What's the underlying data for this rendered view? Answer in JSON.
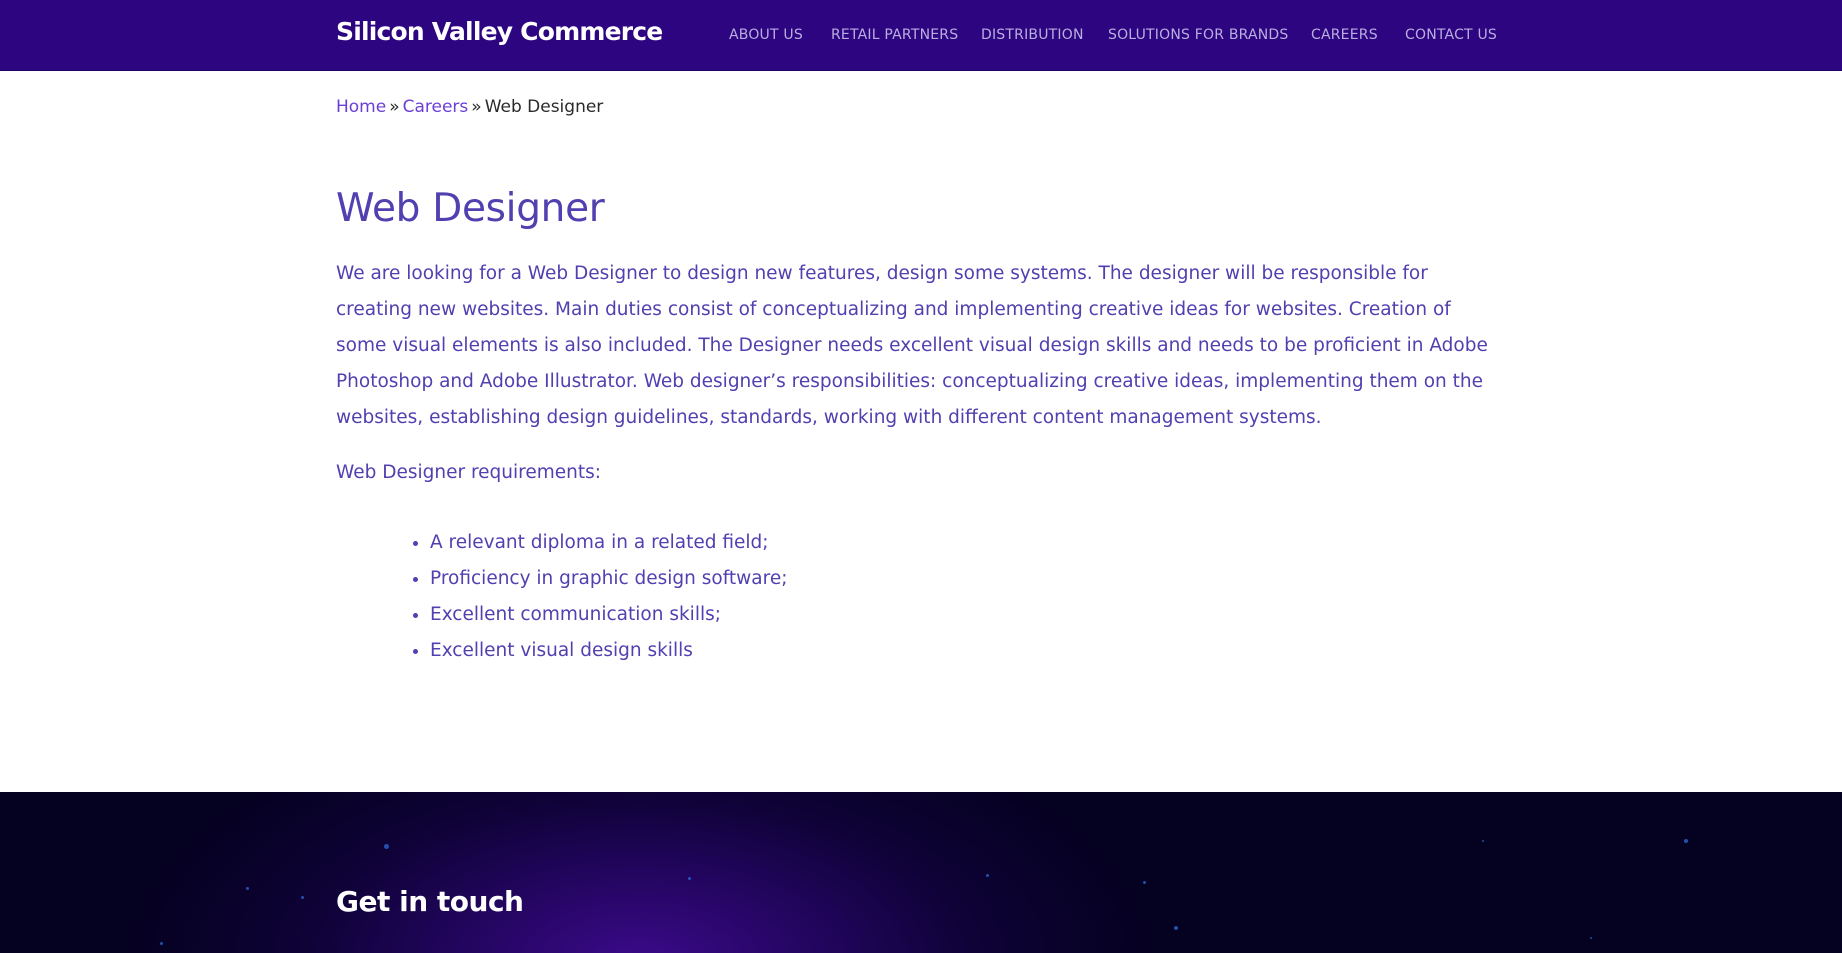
{
  "header": {
    "brand": "Silicon Valley Commerce",
    "nav": [
      {
        "label": "ABOUT US"
      },
      {
        "label": "RETAIL PARTNERS"
      },
      {
        "label": "DISTRIBUTION"
      },
      {
        "label": "SOLUTIONS FOR BRANDS"
      },
      {
        "label": "CAREERS"
      },
      {
        "label": "CONTACT US"
      }
    ]
  },
  "breadcrumb": {
    "home": "Home",
    "separator": "»",
    "careers": "Careers",
    "current": "Web Designer"
  },
  "main": {
    "title": "Web Designer",
    "intro": "We are looking for a Web Designer to design new features, design some systems. The designer will be responsible for creating new websites. Main duties consist of conceptualizing and implementing creative ideas for websites. Creation of some visual elements is also included. The Designer needs excellent visual design skills and needs to be proficient in Adobe Photoshop and Adobe Illustrator. Web designer’s responsibilities: conceptualizing creative ideas, implementing them on the websites, establishing design guidelines, standards, working with different content management systems.",
    "requirements_heading": "Web Designer requirements:",
    "requirements": [
      "A relevant diploma in a related field;",
      "Proficiency in graphic design software;",
      "Excellent communication skills;",
      "Excellent visual design skills"
    ]
  },
  "footer": {
    "title": "Get in touch"
  },
  "colors": {
    "header_bg": "#2e0580",
    "accent_text": "#5040b0",
    "link": "#6b3fd6",
    "footer_bg": "#0e0236"
  }
}
